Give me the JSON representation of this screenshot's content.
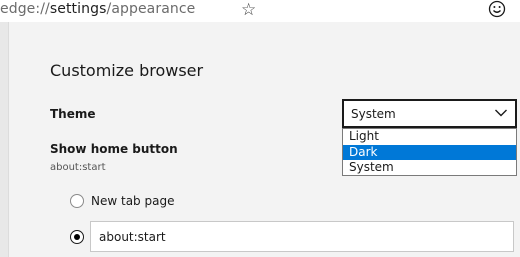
{
  "address_bar": {
    "url_scheme": "edge://",
    "url_host": "settings",
    "url_path": "/appearance",
    "favorite_icon": "star-outline-icon",
    "profile_icon": "smiley-face-icon"
  },
  "section": {
    "title": "Customize browser"
  },
  "theme": {
    "label": "Theme",
    "selected_value": "System",
    "options": [
      "Light",
      "Dark",
      "System"
    ],
    "highlighted_option": "Dark",
    "highlight_color": "#0078d7"
  },
  "home_button": {
    "label": "Show home button",
    "current_value": "about:start",
    "radio_new_tab": "New tab page",
    "custom_url_value": "about:start"
  }
}
